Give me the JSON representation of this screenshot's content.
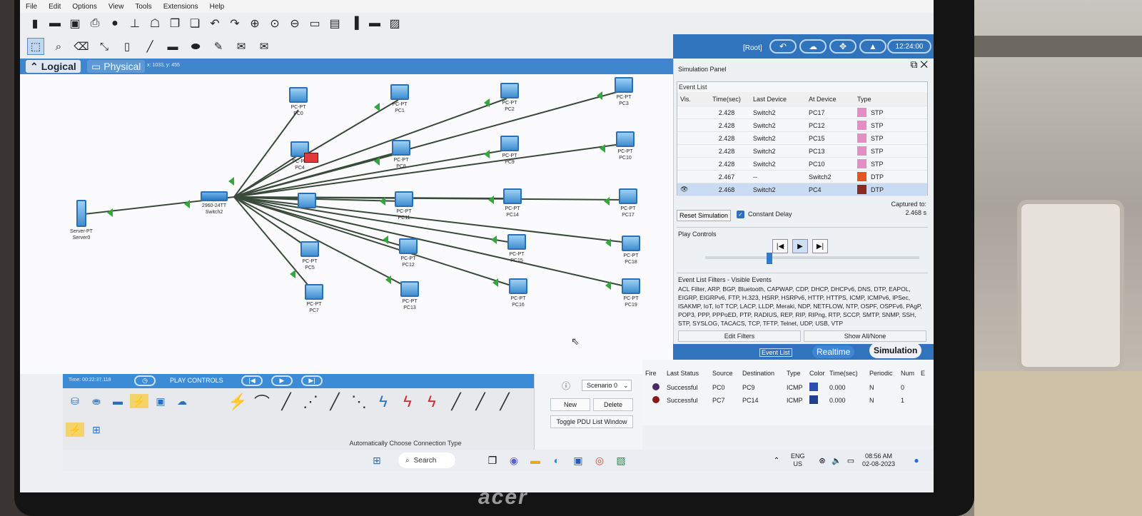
{
  "menu": [
    "File",
    "Edit",
    "Options",
    "View",
    "Tools",
    "Extensions",
    "Help"
  ],
  "tabs": {
    "logical": "Logical",
    "physical": "Physical",
    "coords": "x: 1033, y: 455"
  },
  "root": "[Root]",
  "clock_time": "12:24:00",
  "devices": [
    {
      "type": "PC-PT",
      "name": "PC0"
    },
    {
      "type": "PC-PT",
      "name": "PC1"
    },
    {
      "type": "PC-PT",
      "name": "PC2"
    },
    {
      "type": "PC-PT",
      "name": "PC3"
    },
    {
      "type": "PC-PT",
      "name": "PC4"
    },
    {
      "type": "PC-PT",
      "name": "PC8"
    },
    {
      "type": "PC-PT",
      "name": "PC9"
    },
    {
      "type": "PC-PT",
      "name": "PC10"
    },
    {
      "type": "PC-PT",
      "name": "PC11"
    },
    {
      "type": "PC-PT",
      "name": "PC14"
    },
    {
      "type": "PC-PT",
      "name": "PC17"
    },
    {
      "type": "PC-PT",
      "name": "PC5"
    },
    {
      "type": "PC-PT",
      "name": "PC12"
    },
    {
      "type": "PC-PT",
      "name": "PC15"
    },
    {
      "type": "PC-PT",
      "name": "PC18"
    },
    {
      "type": "PC-PT",
      "name": "PC7"
    },
    {
      "type": "PC-PT",
      "name": "PC13"
    },
    {
      "type": "PC-PT",
      "name": "PC16"
    },
    {
      "type": "PC-PT",
      "name": "PC19"
    },
    {
      "type": "2960-24TT",
      "name": "Switch2"
    },
    {
      "type": "Server-PT",
      "name": "Server0"
    }
  ],
  "panel": {
    "title": "Simulation Panel",
    "event_list": "Event List",
    "columns": [
      "Vis.",
      "Time(sec)",
      "Last Device",
      "At Device",
      "Type"
    ],
    "events": [
      {
        "time": "2.428",
        "last": "Switch2",
        "at": "PC17",
        "type": "STP",
        "color": "#e28fc6"
      },
      {
        "time": "2.428",
        "last": "Switch2",
        "at": "PC12",
        "type": "STP",
        "color": "#e28fc6"
      },
      {
        "time": "2.428",
        "last": "Switch2",
        "at": "PC15",
        "type": "STP",
        "color": "#e28fc6"
      },
      {
        "time": "2.428",
        "last": "Switch2",
        "at": "PC13",
        "type": "STP",
        "color": "#e28fc6"
      },
      {
        "time": "2.428",
        "last": "Switch2",
        "at": "PC10",
        "type": "STP",
        "color": "#e28fc6"
      },
      {
        "time": "2.467",
        "last": "--",
        "at": "Switch2",
        "type": "DTP",
        "color": "#e2542a"
      },
      {
        "time": "2.468",
        "last": "Switch2",
        "at": "PC4",
        "type": "DTP",
        "color": "#8a2a24"
      }
    ],
    "reset": "Reset Simulation",
    "constant_delay": "Constant Delay",
    "captured_label": "Captured to:",
    "captured_value": "2.468 s",
    "play_controls": "Play Controls",
    "filters_title": "Event List Filters - Visible Events",
    "filters_text": "ACL Filter, ARP, BGP, Bluetooth, CAPWAP, CDP, DHCP, DHCPv6, DNS, DTP, EAPOL, EIGRP, EIGRPv6, FTP, H.323, HSRP, HSRPv6, HTTP, HTTPS, ICMP, ICMPv6, IPSec, ISAKMP, IoT, IoT TCP, LACP, LLDP, Meraki, NDP, NETFLOW, NTP, OSPF, OSPFv6, PAgP, POP3, PPP, PPPoED, PTP, RADIUS, REP, RIP, RIPng, RTP, SCCP, SMTP, SNMP, SSH, STP, SYSLOG, TACACS, TCP, TFTP, Telnet, UDP, USB, VTP",
    "edit_filters": "Edit Filters",
    "show_all": "Show All/None"
  },
  "modes": {
    "event_list": "Event List",
    "realtime": "Realtime",
    "simulation": "Simulation"
  },
  "bottom": {
    "time": "Time: 00:22:37.118",
    "play_controls": "PLAY CONTROLS",
    "auto_conn": "Automatically Choose Connection Type",
    "scenario": "Scenario 0",
    "new": "New",
    "delete": "Delete",
    "toggle_pdu": "Toggle PDU List Window"
  },
  "pdu": {
    "columns": [
      "Fire",
      "Last Status",
      "Source",
      "Destination",
      "Type",
      "Color",
      "Time(sec)",
      "Periodic",
      "Num",
      "E"
    ],
    "rows": [
      {
        "status": "Successful",
        "source": "PC0",
        "dest": "PC9",
        "type": "ICMP",
        "color": "#2b4fb0",
        "time": "0.000",
        "periodic": "N",
        "num": "0"
      },
      {
        "status": "Successful",
        "source": "PC7",
        "dest": "PC14",
        "type": "ICMP",
        "color": "#1f3f8f",
        "time": "0.000",
        "periodic": "N",
        "num": "1"
      }
    ]
  },
  "taskbar": {
    "search": "Search",
    "lang": "ENG",
    "region": "US",
    "time": "08:56 AM",
    "date": "02-08-2023"
  },
  "brand": "acer"
}
